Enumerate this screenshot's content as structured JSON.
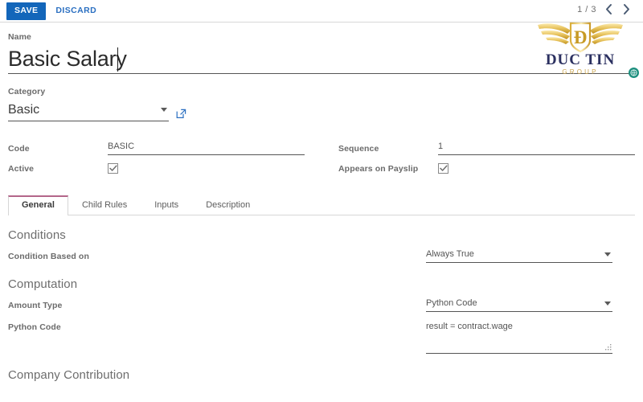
{
  "control_panel": {
    "save_label": "SAVE",
    "discard_label": "DISCARD",
    "pager_text": "1 / 3",
    "prev_icon": "chevron-left-icon",
    "next_icon": "chevron-right-icon"
  },
  "branding": {
    "logo_name": "DUC TIN",
    "logo_subtitle": "GROUP",
    "logo_monogram": "DT",
    "colors": {
      "gold_light": "#f7df9a",
      "gold_dark": "#c79a25",
      "navy": "#2b3060"
    }
  },
  "form": {
    "name_label": "Name",
    "name_value": "Basic Salary",
    "name_placeholder": "Name",
    "category_label": "Category",
    "category_value": "Basic",
    "category_external_icon": "external-link-icon",
    "code_label": "Code",
    "code_value": "BASIC",
    "active_label": "Active",
    "active_checked": true,
    "sequence_label": "Sequence",
    "sequence_value": "1",
    "payslip_label": "Appears on Payslip",
    "payslip_checked": true
  },
  "notebook": {
    "tabs": [
      {
        "label": "General",
        "active": true
      },
      {
        "label": "Child Rules",
        "active": false
      },
      {
        "label": "Inputs",
        "active": false
      },
      {
        "label": "Description",
        "active": false
      }
    ]
  },
  "general_page": {
    "conditions_title": "Conditions",
    "condition_based_label": "Condition Based on",
    "condition_based_value": "Always True",
    "computation_title": "Computation",
    "amount_type_label": "Amount Type",
    "amount_type_value": "Python Code",
    "python_code_label": "Python Code",
    "python_code_value": "result = contract.wage",
    "company_contribution_title": "Company Contribution"
  },
  "theme": {
    "primary": "#1366ba",
    "link": "#2a6fc1",
    "active_tab_accent": "#b3668a",
    "badge_green": "#1d8f7e"
  }
}
